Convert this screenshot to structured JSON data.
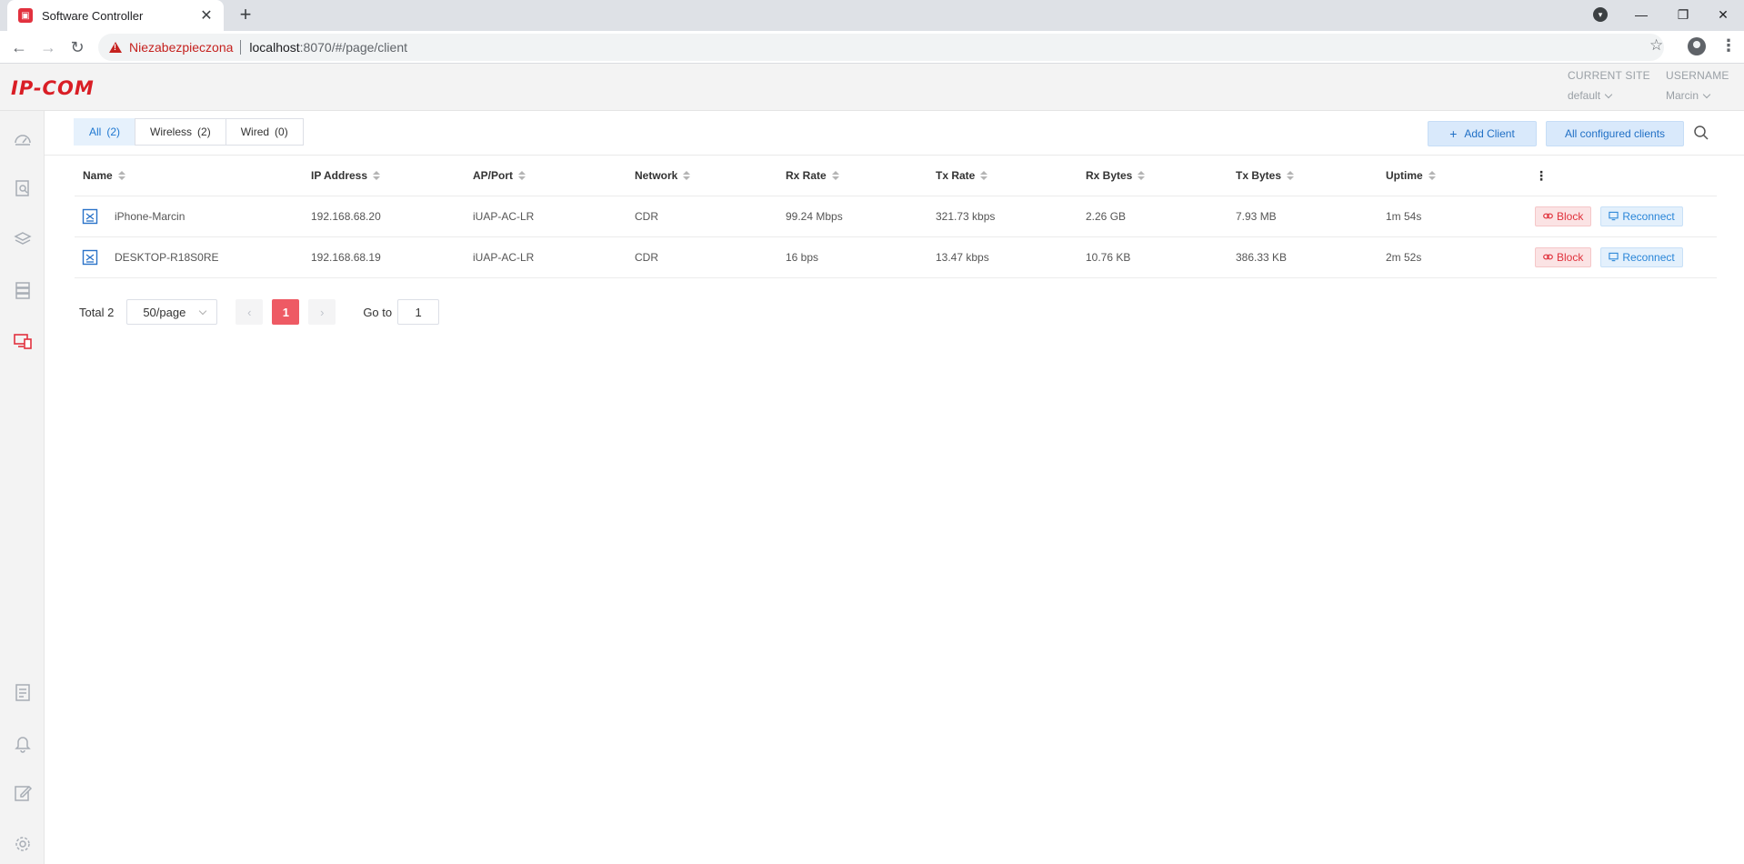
{
  "browser": {
    "tab_title": "Software Controller",
    "tab_close": "✕",
    "new_tab": "+",
    "insecure_label": "Niezabezpieczona",
    "url_host": "localhost",
    "url_rest": ":8070/#/page/client"
  },
  "app": {
    "logo": "IP-COM",
    "current_site_label": "CURRENT SITE",
    "current_site_value": "default",
    "username_label": "USERNAME",
    "username_value": "Marcin"
  },
  "filters": {
    "tabs": [
      {
        "label": "All",
        "count": "(2)"
      },
      {
        "label": "Wireless",
        "count": "(2)"
      },
      {
        "label": "Wired",
        "count": "(0)"
      }
    ],
    "add_client": "Add Client",
    "all_configured": "All configured clients"
  },
  "table": {
    "columns": [
      "Name",
      "IP Address",
      "AP/Port",
      "Network",
      "Rx Rate",
      "Tx Rate",
      "Rx Bytes",
      "Tx Bytes",
      "Uptime"
    ],
    "rows": [
      {
        "name": "iPhone-Marcin",
        "ip": "192.168.68.20",
        "ap": "iUAP-AC-LR",
        "network": "CDR",
        "rx_rate": "99.24 Mbps",
        "tx_rate": "321.73 kbps",
        "rx_bytes": "2.26 GB",
        "tx_bytes": "7.93 MB",
        "uptime": "1m 54s"
      },
      {
        "name": "DESKTOP-R18S0RE",
        "ip": "192.168.68.19",
        "ap": "iUAP-AC-LR",
        "network": "CDR",
        "rx_rate": "16 bps",
        "tx_rate": "13.47 kbps",
        "rx_bytes": "10.76 KB",
        "tx_bytes": "386.33 KB",
        "uptime": "2m 52s"
      }
    ],
    "block_label": "Block",
    "reconnect_label": "Reconnect"
  },
  "pagination": {
    "total": "Total 2",
    "page_size": "50/page",
    "current_page": "1",
    "goto_label": "Go to",
    "goto_value": "1"
  },
  "colors": {
    "brand": "#d91e25",
    "accent": "#1f78d1",
    "danger": "#e0323c"
  }
}
